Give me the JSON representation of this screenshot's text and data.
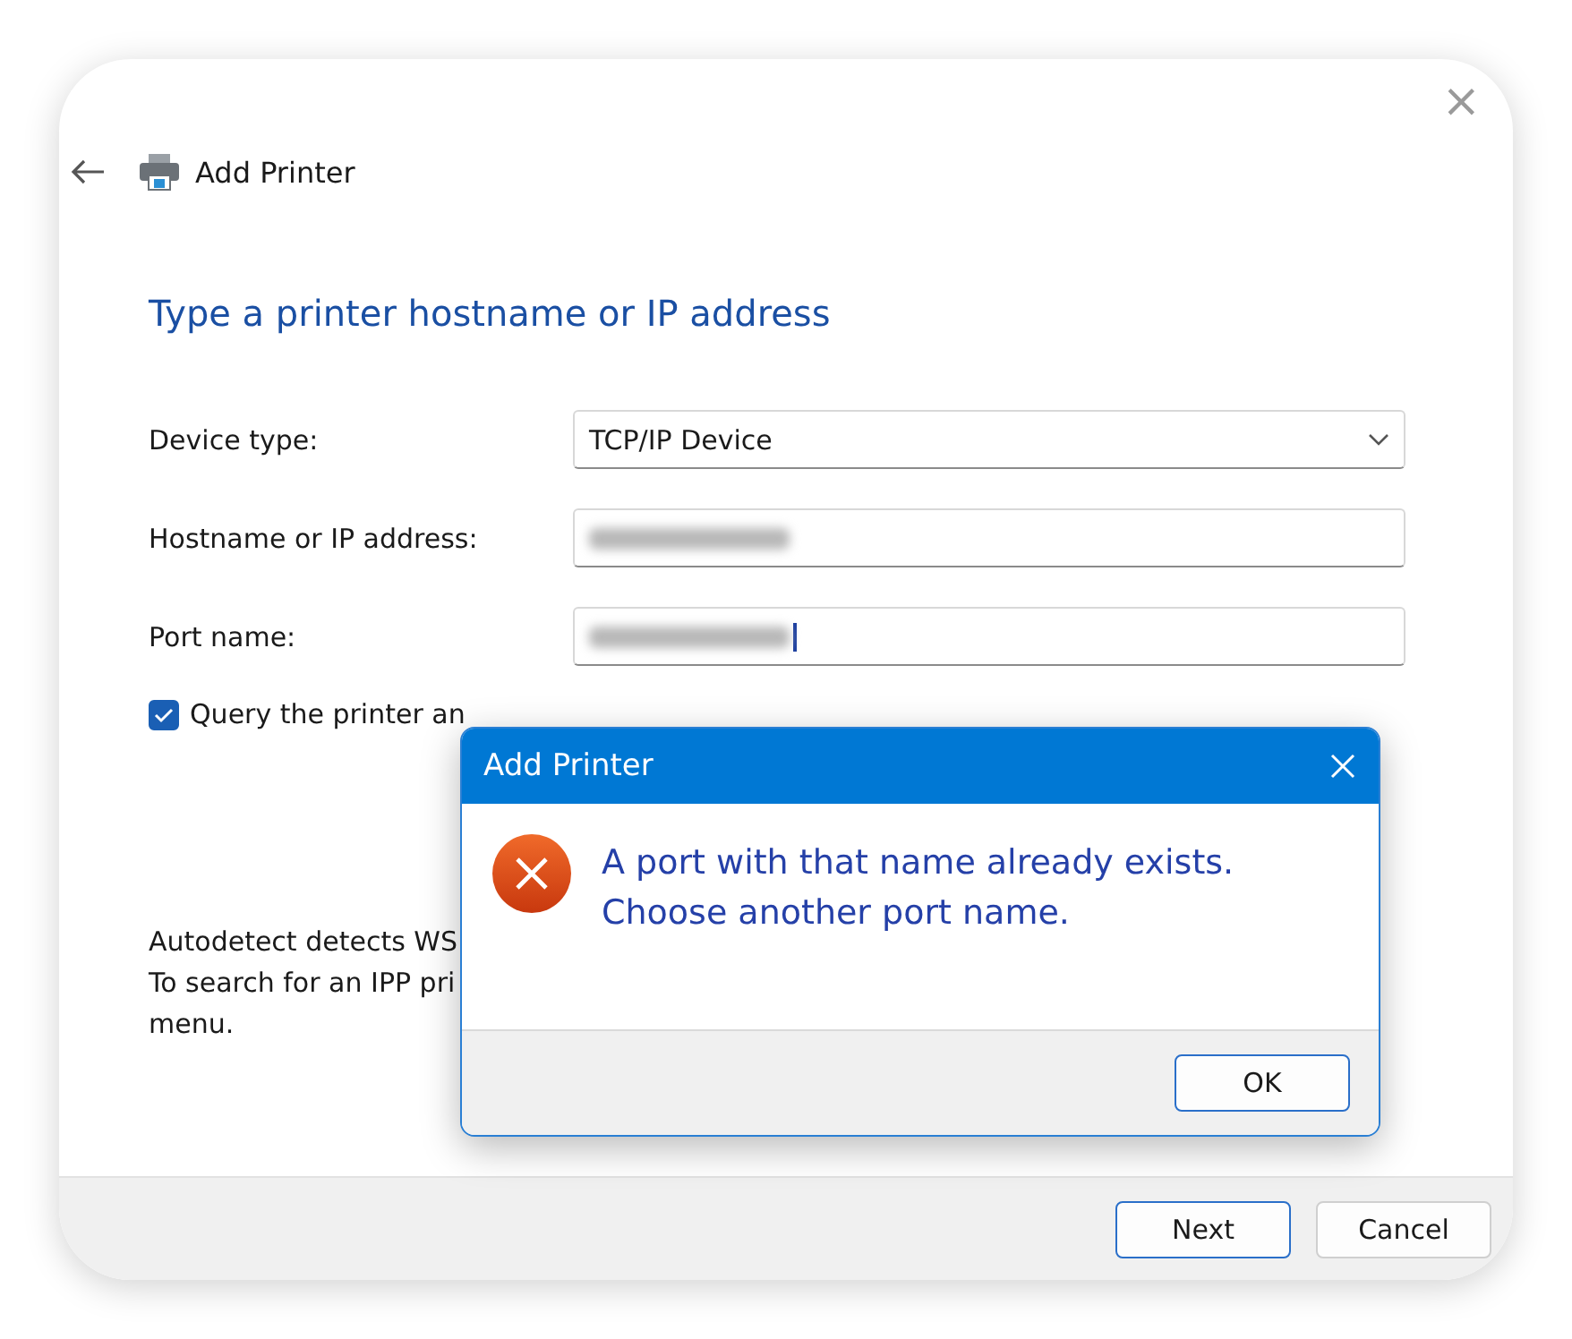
{
  "window": {
    "title": "Add Printer",
    "close": "×"
  },
  "heading": "Type a printer hostname or IP address",
  "fields": [
    {
      "kind": "dropdown",
      "label": "Device type:",
      "value": "TCP/IP Device"
    },
    {
      "kind": "redacted",
      "label": "Hostname or IP address:"
    },
    {
      "kind": "redacted",
      "label": "Port name:",
      "caret": true
    }
  ],
  "query_checkbox": {
    "label": "Query the printer an",
    "checked": true
  },
  "note_lines": [
    "Autodetect detects WS",
    "To search for an IPP pri",
    "menu."
  ],
  "buttons": [
    {
      "label": "Next",
      "default": true
    },
    {
      "label": "Cancel",
      "default": false
    }
  ],
  "dialog": {
    "title": "Add Printer",
    "message_lines": [
      "A port with that name already exists.",
      "Choose another port name."
    ],
    "button": "OK"
  }
}
